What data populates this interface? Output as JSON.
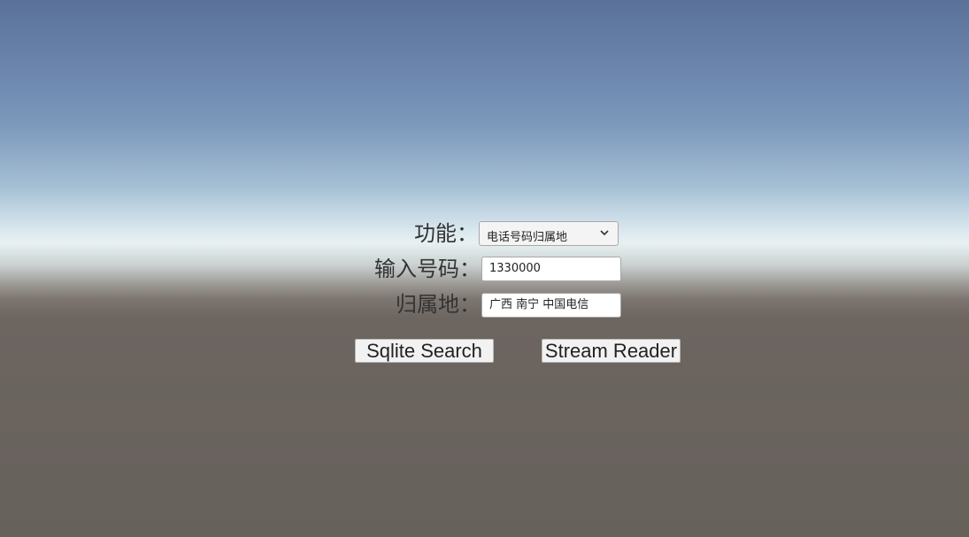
{
  "form": {
    "function_label": "功能：",
    "function_select": {
      "selected": "电话号码归属地",
      "icon": "chevron-down-icon"
    },
    "phone_label": "输入号码：",
    "phone_value": "1330000",
    "location_label": "归属地：",
    "location_value": "广西 南宁 中国电信"
  },
  "buttons": {
    "sqlite_label": "Sqlite Search",
    "stream_label": "Stream Reader"
  },
  "colors": {
    "sky_top": "#5a7299",
    "horizon": "#e8f1f2",
    "ground": "#67615c",
    "label_text": "#333333",
    "button_bg": "#f2f2f2"
  }
}
